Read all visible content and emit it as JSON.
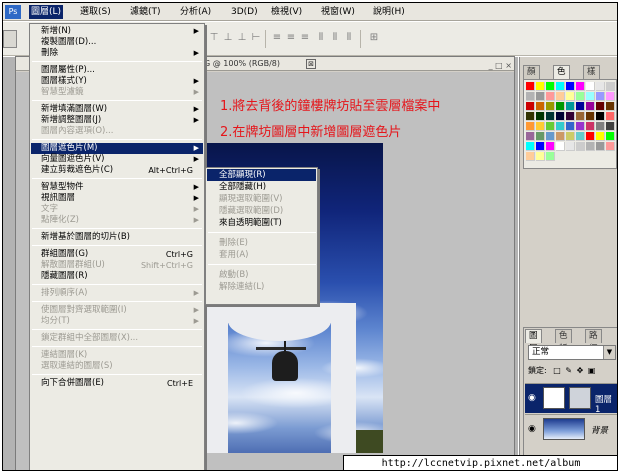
{
  "menubar": {
    "items": [
      "圖層(L)",
      "選取(S)",
      "濾鏡(T)",
      "分析(A)",
      "3D(D)",
      "檢視(V)",
      "視窗(W)",
      "說明(H)"
    ],
    "active_index": 0
  },
  "document": {
    "title": "G @ 100% (RGB/8)",
    "close_glyph": "⊠"
  },
  "instructions": {
    "line1": "1.將去背後的鐘樓牌坊貼至雲層檔案中",
    "line2": "2.在牌坊圖層中新增圖層遮色片"
  },
  "layer_menu": {
    "items": [
      {
        "label": "新增(N)",
        "arrow": "▶"
      },
      {
        "label": "複製圖層(D)..."
      },
      {
        "label": "刪除",
        "arrow": "▶"
      },
      {
        "sep": true
      },
      {
        "label": "圖層屬性(P)..."
      },
      {
        "label": "圖層樣式(Y)",
        "arrow": "▶"
      },
      {
        "label": "智慧型濾鏡",
        "disabled": true,
        "arrow": "▶"
      },
      {
        "sep": true
      },
      {
        "label": "新增填滿圖層(W)",
        "arrow": "▶"
      },
      {
        "label": "新增調整圖層(J)",
        "arrow": "▶"
      },
      {
        "label": "圖層內容選項(O)...",
        "disabled": true
      },
      {
        "sep": true
      },
      {
        "label": "圖層遮色片(M)",
        "arrow": "▶",
        "highlight": true
      },
      {
        "label": "向量圖遮色片(V)",
        "arrow": "▶"
      },
      {
        "label": "建立剪裁遮色片(C)",
        "shortcut": "Alt+Ctrl+G"
      },
      {
        "sep": true
      },
      {
        "label": "智慧型物件",
        "arrow": "▶"
      },
      {
        "label": "視訊圖層",
        "arrow": "▶"
      },
      {
        "label": "文字",
        "disabled": true,
        "arrow": "▶"
      },
      {
        "label": "點陣化(Z)",
        "disabled": true,
        "arrow": "▶"
      },
      {
        "sep": true
      },
      {
        "label": "新增基於圖層的切片(B)"
      },
      {
        "sep": true
      },
      {
        "label": "群組圖層(G)",
        "shortcut": "Ctrl+G"
      },
      {
        "label": "解散圖層群組(U)",
        "shortcut": "Shift+Ctrl+G",
        "disabled": true
      },
      {
        "label": "隱藏圖層(R)"
      },
      {
        "sep": true
      },
      {
        "label": "排列順序(A)",
        "disabled": true,
        "arrow": "▶"
      },
      {
        "sep": true
      },
      {
        "label": "使圖層對齊選取範圍(I)",
        "disabled": true,
        "arrow": "▶"
      },
      {
        "label": "均分(T)",
        "disabled": true,
        "arrow": "▶"
      },
      {
        "sep": true
      },
      {
        "label": "鎖定群組中全部圖層(X)...",
        "disabled": true
      },
      {
        "sep": true
      },
      {
        "label": "連結圖層(K)",
        "disabled": true
      },
      {
        "label": "選取連結的圖層(S)",
        "disabled": true
      },
      {
        "sep": true
      },
      {
        "label": "向下合併圖層(E)",
        "shortcut": "Ctrl+E"
      }
    ]
  },
  "mask_submenu": {
    "items": [
      {
        "label": "全部顯現(R)",
        "highlight": true
      },
      {
        "label": "全部隱藏(H)"
      },
      {
        "label": "顯現選取範圍(V)",
        "disabled": true
      },
      {
        "label": "隱藏選取範圍(D)",
        "disabled": true
      },
      {
        "label": "來自透明範圍(T)"
      },
      {
        "sep": true
      },
      {
        "label": "刪除(E)",
        "disabled": true
      },
      {
        "label": "套用(A)",
        "disabled": true
      },
      {
        "sep": true
      },
      {
        "label": "啟動(B)",
        "disabled": true
      },
      {
        "label": "解除連結(L)",
        "disabled": true
      }
    ]
  },
  "panels": {
    "color_tabs": [
      "顏色",
      "色票",
      "樣式"
    ],
    "color_active_index": 1,
    "layers_tabs": [
      "圖層",
      "色版",
      "路徑"
    ],
    "layers_active_index": 0,
    "blend_mode": "正常",
    "lock_label": "鎖定:",
    "layers": [
      {
        "name": "圖層 1",
        "selected": true
      },
      {
        "name": "背景",
        "selected": false
      }
    ]
  },
  "footer": {
    "url": "http://lccnetvip.pixnet.net/album"
  },
  "swatch_colors": [
    "#ff0000",
    "#ffff00",
    "#00ff00",
    "#00ffff",
    "#0000ff",
    "#ff00ff",
    "#ffffff",
    "#e6e6e6",
    "#cccccc",
    "#b3b3b3",
    "#999999"
  ]
}
